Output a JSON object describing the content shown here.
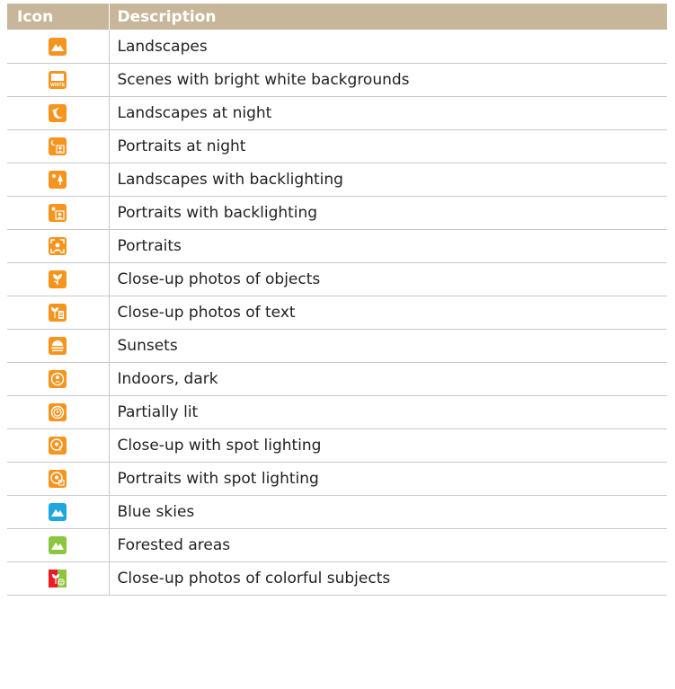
{
  "table": {
    "headers": {
      "icon": "Icon",
      "description": "Description"
    },
    "rows": [
      {
        "icon": "landscape-icon",
        "color": "#f7941d",
        "description": "Landscapes"
      },
      {
        "icon": "white-scene-icon",
        "color": "#f7941d",
        "description": "Scenes with bright white backgrounds",
        "icon_text": "WHITE"
      },
      {
        "icon": "night-landscape-icon",
        "color": "#f7941d",
        "description": "Landscapes at night"
      },
      {
        "icon": "night-portrait-icon",
        "color": "#f7941d",
        "description": "Portraits at night"
      },
      {
        "icon": "backlit-landscape-icon",
        "color": "#f7941d",
        "description": "Landscapes with backlighting"
      },
      {
        "icon": "backlit-portrait-icon",
        "color": "#f7941d",
        "description": "Portraits with backlighting"
      },
      {
        "icon": "portrait-icon",
        "color": "#f7941d",
        "description": "Portraits"
      },
      {
        "icon": "macro-object-icon",
        "color": "#f7941d",
        "description": "Close-up photos of objects"
      },
      {
        "icon": "macro-text-icon",
        "color": "#f7941d",
        "description": "Close-up photos of text"
      },
      {
        "icon": "sunset-icon",
        "color": "#f7941d",
        "description": "Sunsets"
      },
      {
        "icon": "indoor-dark-icon",
        "color": "#f7941d",
        "description": "Indoors, dark"
      },
      {
        "icon": "partially-lit-icon",
        "color": "#f7941d",
        "description": "Partially lit"
      },
      {
        "icon": "spot-closeup-icon",
        "color": "#f7941d",
        "description": "Close-up with spot lighting"
      },
      {
        "icon": "spot-portrait-icon",
        "color": "#f7941d",
        "description": "Portraits with spot lighting"
      },
      {
        "icon": "blue-sky-icon",
        "color": "#1fa8e0",
        "description": "Blue skies"
      },
      {
        "icon": "forest-icon",
        "color": "#8cc63f",
        "description": "Forested areas"
      },
      {
        "icon": "colorful-macro-icon",
        "color": "#f7941d",
        "description": "Close-up photos of colorful subjects"
      }
    ]
  }
}
